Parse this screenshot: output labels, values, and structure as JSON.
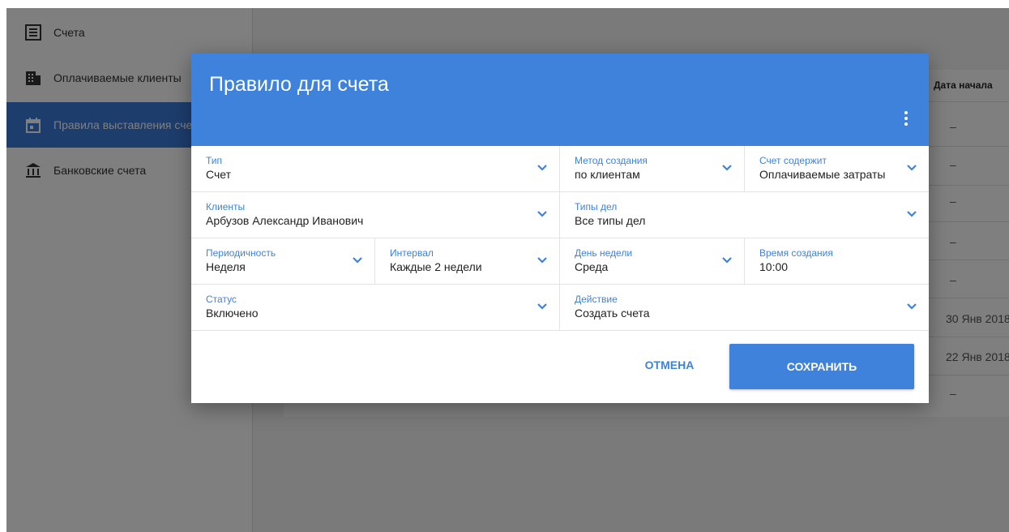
{
  "sidebar": {
    "items": [
      {
        "label": "Счета",
        "icon": "invoice-list-icon"
      },
      {
        "label": "Оплачиваемые клиенты",
        "icon": "building-icon"
      },
      {
        "label": "Правила выставления счетов",
        "icon": "calendar-icon",
        "active": true
      },
      {
        "label": "Банковские счета",
        "icon": "bank-icon"
      }
    ]
  },
  "table": {
    "column_header": "Дата начала",
    "cells": [
      "–",
      "–",
      "–",
      "–",
      "–",
      "30 Янв 2018",
      "22 Янв 2018",
      "–"
    ]
  },
  "dialog": {
    "title": "Правило для счета",
    "fields": {
      "type": {
        "label": "Тип",
        "value": "Счет"
      },
      "creation_method": {
        "label": "Метод создания",
        "value": "по клиентам"
      },
      "invoice_contains": {
        "label": "Счет содержит",
        "value": "Оплачиваемые затраты"
      },
      "clients": {
        "label": "Клиенты",
        "value": "Арбузов Александр Иванович"
      },
      "case_types": {
        "label": "Типы дел",
        "value": "Все типы дел"
      },
      "periodicity": {
        "label": "Периодичность",
        "value": "Неделя"
      },
      "interval": {
        "label": "Интервал",
        "value": "Каждые 2 недели"
      },
      "weekday": {
        "label": "День недели",
        "value": "Среда"
      },
      "creation_time": {
        "label": "Время создания",
        "value": "10:00"
      },
      "status": {
        "label": "Статус",
        "value": "Включено"
      },
      "action": {
        "label": "Действие",
        "value": "Создать счета"
      }
    },
    "buttons": {
      "cancel": "ОТМЕНА",
      "save": "СОХРАНИТЬ"
    }
  },
  "colors": {
    "accent": "#3f82db",
    "sidebar_active": "#3b7ad9",
    "scrim": "rgba(0,0,0,0.5)"
  }
}
